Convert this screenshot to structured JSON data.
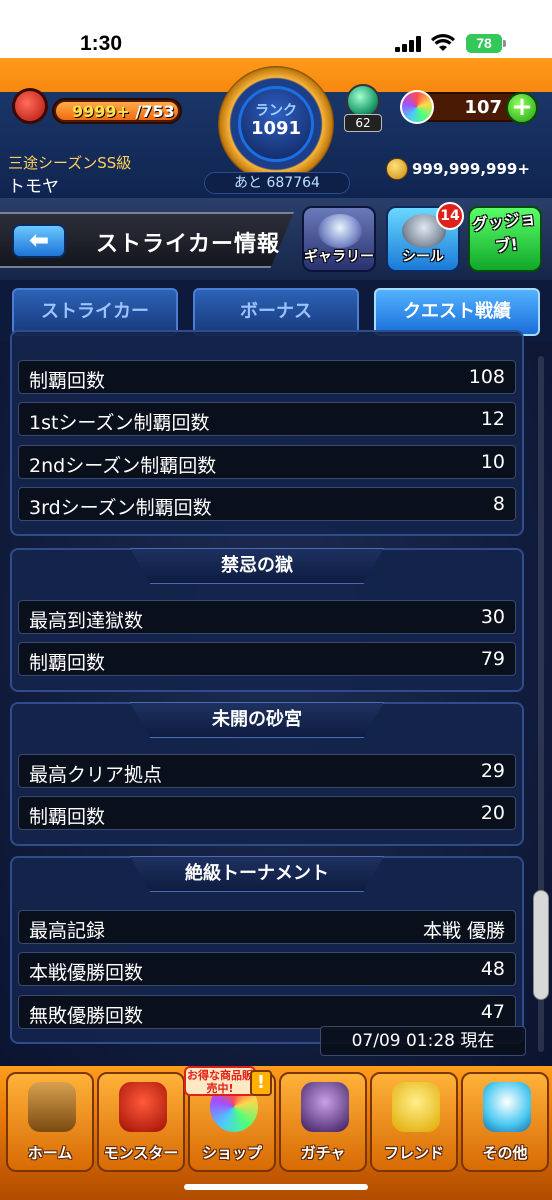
{
  "status_bar": {
    "time": "1:30",
    "battery": "78"
  },
  "header": {
    "stamina_current": "9999+",
    "stamina_max": " /753",
    "rank_label": "ランク",
    "rank_value": "1091",
    "rank_next": "あと 687764",
    "item_count": "62",
    "orb_count": "107",
    "plus_label": "+",
    "user_class": "三途シーズンSS級",
    "user_name": "トモヤ",
    "coins": "999,999,999+"
  },
  "title_bar": {
    "back_label": "⬅",
    "title": "ストライカー情報",
    "gallery_label": "ギャラリー",
    "seal_label": "シール",
    "seal_badge": "14",
    "goods_label": "グッジョブ!"
  },
  "tabs": [
    {
      "label": "ストライカー",
      "active": false
    },
    {
      "label": "ボーナス",
      "active": false
    },
    {
      "label": "クエスト戦績",
      "active": true
    }
  ],
  "sections": {
    "top": {
      "rows": [
        {
          "label": "制覇回数",
          "value": "108"
        },
        {
          "label": "1stシーズン制覇回数",
          "value": "12"
        },
        {
          "label": "2ndシーズン制覇回数",
          "value": "10"
        },
        {
          "label": "3rdシーズン制覇回数",
          "value": "8"
        }
      ]
    },
    "forbidden": {
      "title": "禁忌の獄",
      "rows": [
        {
          "label": "最高到達獄数",
          "value": "30"
        },
        {
          "label": "制覇回数",
          "value": "79"
        }
      ]
    },
    "sand": {
      "title": "未開の砂宮",
      "rows": [
        {
          "label": "最高クリア拠点",
          "value": "29"
        },
        {
          "label": "制覇回数",
          "value": "20"
        }
      ]
    },
    "tournament": {
      "title": "絶級トーナメント",
      "rows": [
        {
          "label": "最高記録",
          "value": "本戦 優勝"
        },
        {
          "label": "本戦優勝回数",
          "value": "48"
        },
        {
          "label": "無敗優勝回数",
          "value": "47"
        }
      ]
    }
  },
  "timestamp": "07/09 01:28 現在",
  "bottom_nav": {
    "home": "ホーム",
    "monster": "モンスター",
    "shop": "ショップ",
    "shop_tag": "お得な商品販売中!",
    "shop_alert": "!",
    "gacha": "ガチャ",
    "friend": "フレンド",
    "other": "その他"
  },
  "colors": {
    "accent_orange": "#f07a08",
    "tab_active": "#1a6ed8",
    "panel_bg": "#14244c"
  }
}
